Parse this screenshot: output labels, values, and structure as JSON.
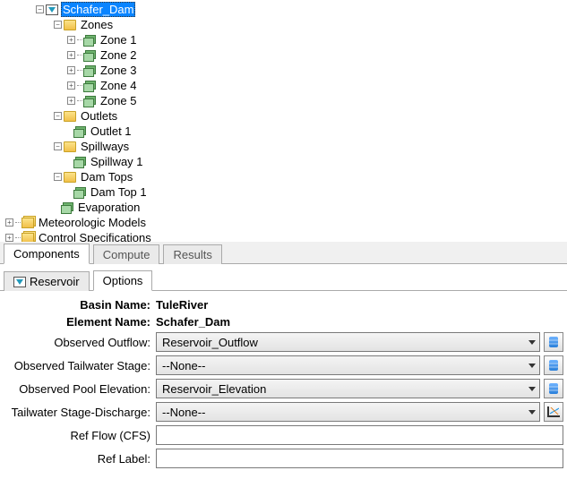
{
  "tree": {
    "selected_label": "Schafer_Dam",
    "zones_folder": "Zones",
    "zone_items": [
      "Zone 1",
      "Zone 2",
      "Zone 3",
      "Zone 4",
      "Zone 5"
    ],
    "outlets_folder": "Outlets",
    "outlet_items": [
      "Outlet 1"
    ],
    "spillways_folder": "Spillways",
    "spillway_items": [
      "Spillway 1"
    ],
    "damtops_folder": "Dam Tops",
    "damtop_items": [
      "Dam Top 1"
    ],
    "evaporation": "Evaporation",
    "meteorologic": "Meteorologic Models",
    "control_specs": "Control Specifications"
  },
  "tabs": {
    "components": "Components",
    "compute": "Compute",
    "results": "Results"
  },
  "sub_tabs": {
    "reservoir": "Reservoir",
    "options": "Options"
  },
  "form": {
    "basin_name_label": "Basin Name:",
    "basin_name_value": "TuleRiver",
    "element_name_label": "Element Name:",
    "element_name_value": "Schafer_Dam",
    "observed_outflow_label": "Observed Outflow:",
    "observed_outflow_value": "Reservoir_Outflow",
    "observed_tailwater_label": "Observed Tailwater Stage:",
    "observed_tailwater_value": "--None--",
    "observed_pool_label": "Observed Pool Elevation:",
    "observed_pool_value": "Reservoir_Elevation",
    "tailwater_discharge_label": "Tailwater Stage-Discharge:",
    "tailwater_discharge_value": "--None--",
    "ref_flow_label": "Ref Flow (CFS)",
    "ref_flow_value": "",
    "ref_label_label": "Ref Label:",
    "ref_label_value": ""
  }
}
